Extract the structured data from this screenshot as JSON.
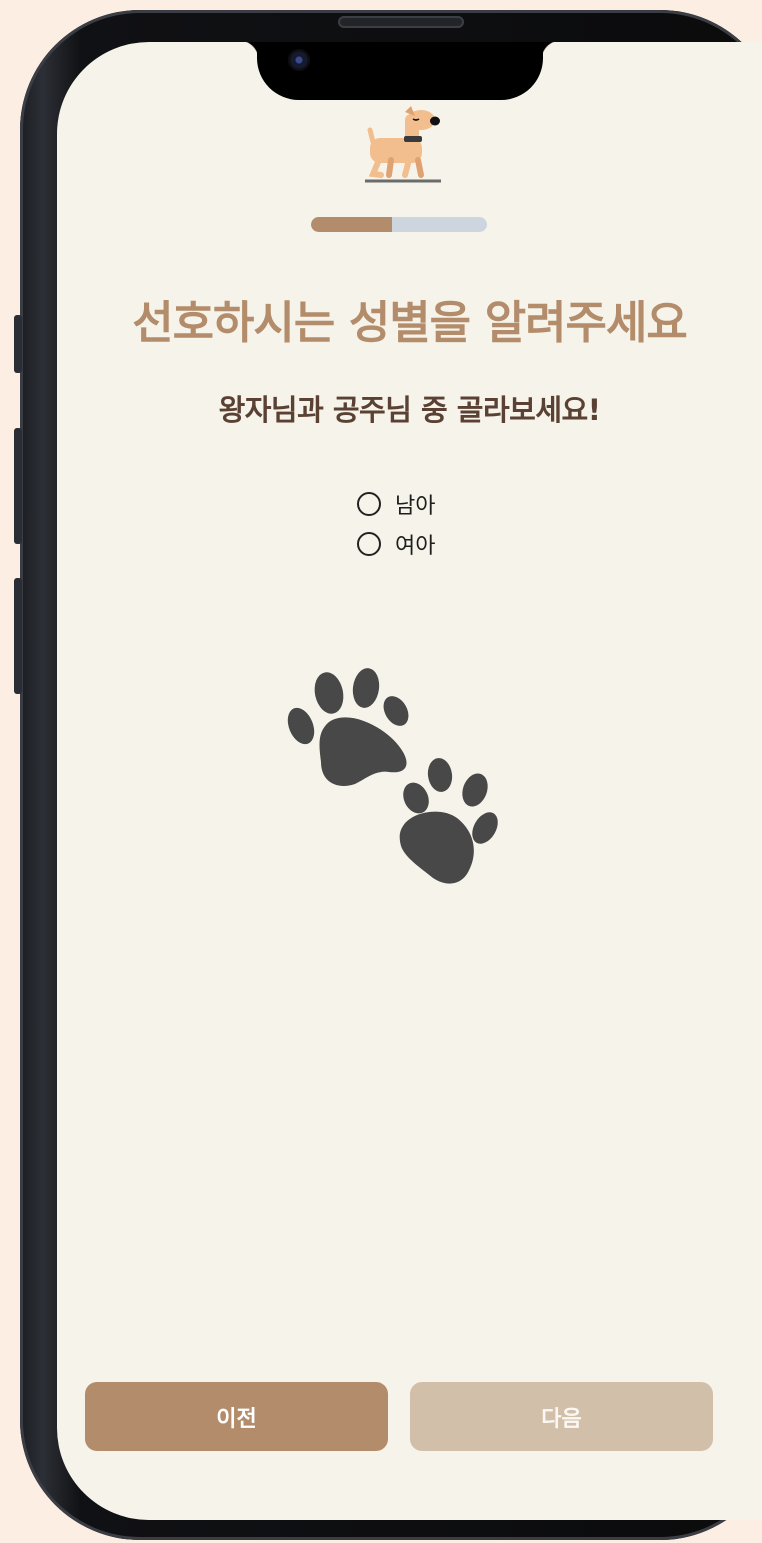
{
  "header": {
    "progress_fraction": 0.46
  },
  "question": {
    "title": "선호하시는 성별을 알려주세요",
    "subtitle": "왕자님과 공주님 중 골라보세요!"
  },
  "options": [
    {
      "label": "남아",
      "selected": false
    },
    {
      "label": "여아",
      "selected": false
    }
  ],
  "footer": {
    "prev_label": "이전",
    "next_label": "다음"
  },
  "colors": {
    "accent": "#b38d6b",
    "accent_disabled": "#d2bfa9",
    "background": "#f6f4ea",
    "progress_track": "#cdd5df",
    "subtitle_text": "#5b4133"
  },
  "icons": {
    "header": "dog-icon",
    "decoration": "paw-prints-icon"
  }
}
